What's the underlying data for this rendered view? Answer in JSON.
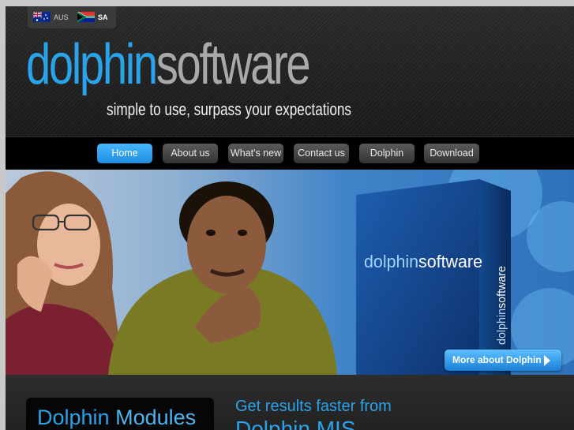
{
  "languages": [
    {
      "code": "AUS"
    },
    {
      "code": "SA"
    }
  ],
  "logo": {
    "part1": "dolphin",
    "part2": "software"
  },
  "tagline": "simple to use, surpass your expectations",
  "nav": [
    {
      "label": "Home"
    },
    {
      "label": "About us"
    },
    {
      "label": "What's new"
    },
    {
      "label": "Contact us"
    },
    {
      "label": "Dolphin"
    },
    {
      "label": "Download"
    }
  ],
  "banner": {
    "box_logo_part1": "dolphin",
    "box_logo_part2": "software",
    "box_side_part1": "dolphin",
    "box_side_part2": "software",
    "more_button": "More about Dolphin"
  },
  "bottom": {
    "modules_part1": "Dolphin",
    "modules_part2": "Modules",
    "results_line1": "Get results faster from",
    "results_line2": "Dolphin MIS"
  },
  "colors": {
    "accent": "#2aa3ea",
    "background": "#0e0e0e"
  }
}
